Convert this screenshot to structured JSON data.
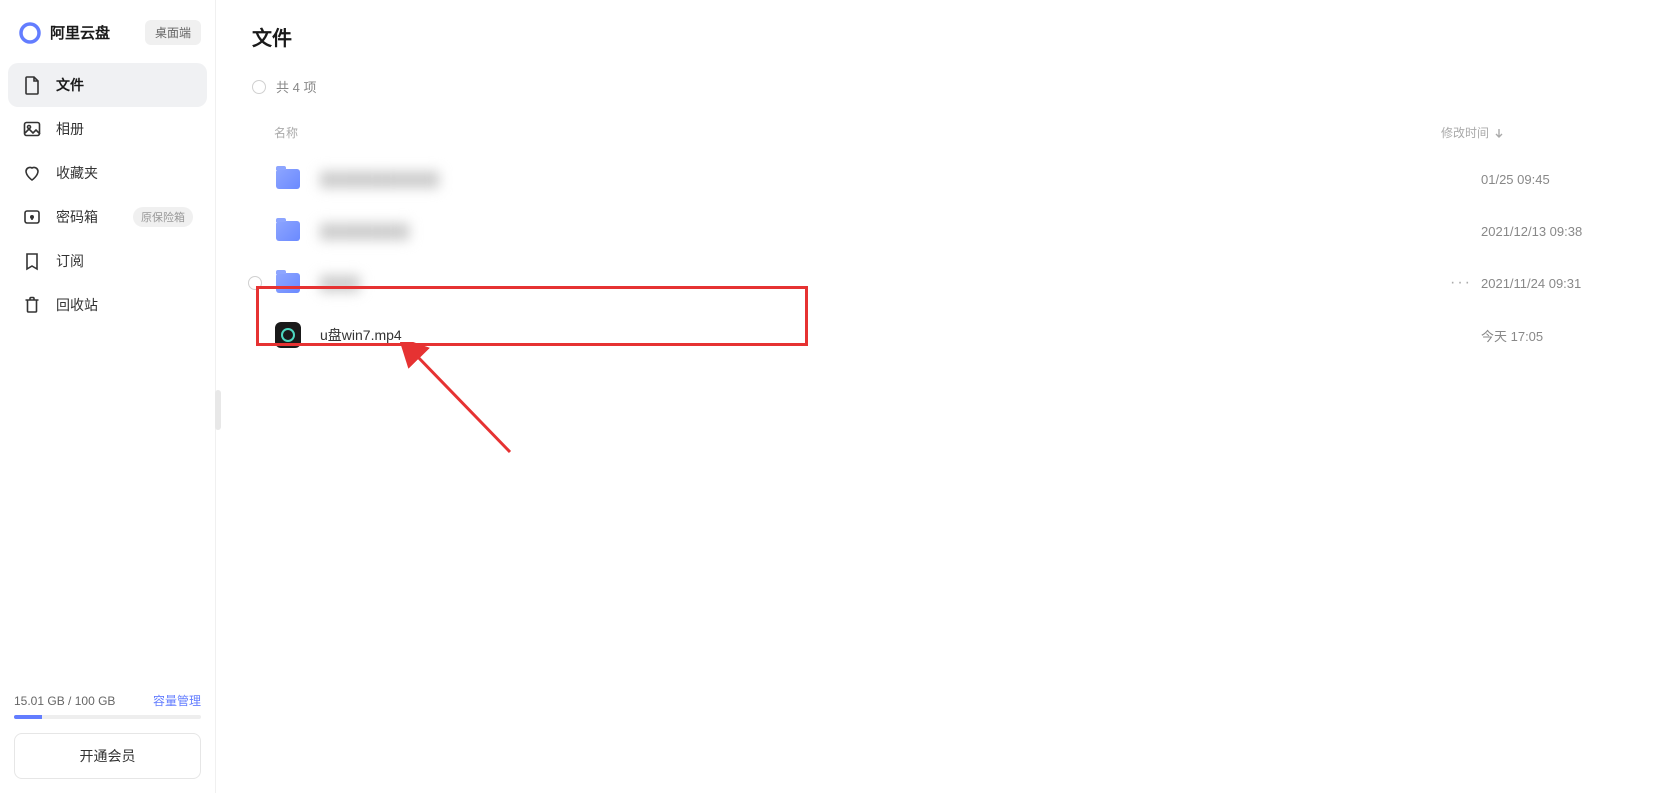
{
  "app": {
    "name": "阿里云盘",
    "desktop_badge": "桌面端"
  },
  "sidebar": {
    "items": [
      {
        "label": "文件",
        "icon": "file"
      },
      {
        "label": "相册",
        "icon": "album"
      },
      {
        "label": "收藏夹",
        "icon": "heart"
      },
      {
        "label": "密码箱",
        "icon": "lock",
        "tag": "原保险箱"
      },
      {
        "label": "订阅",
        "icon": "bookmark"
      },
      {
        "label": "回收站",
        "icon": "trash"
      }
    ],
    "storage": {
      "used": "15.01 GB",
      "total": "100 GB",
      "manage": "容量管理"
    },
    "vip_btn": "开通会员"
  },
  "main": {
    "title": "文件",
    "count": "共 4 项",
    "columns": {
      "name": "名称",
      "time": "修改时间"
    },
    "files": [
      {
        "name": "████████████",
        "time": "01/25 09:45",
        "type": "folder",
        "blurred": true
      },
      {
        "name": "█████████",
        "time": "2021/12/13 09:38",
        "type": "folder",
        "blurred": true
      },
      {
        "name": "████",
        "time": "2021/11/24 09:31",
        "type": "folder",
        "blurred": true,
        "hovered": true
      },
      {
        "name": "u盘win7.mp4",
        "time": "今天 17:05",
        "type": "video",
        "blurred": false
      }
    ]
  }
}
